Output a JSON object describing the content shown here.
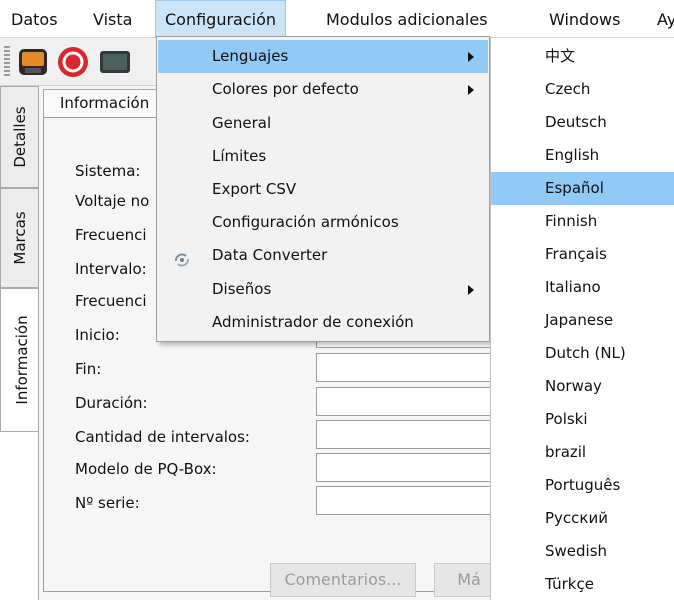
{
  "menubar": {
    "items": [
      "Datos",
      "Vista",
      "Configuración",
      "Modulos adicionales",
      "Windows",
      "Ay"
    ],
    "active_index": 2
  },
  "toolbar": {
    "buttons": [
      "disk-save-icon",
      "refresh-icon",
      "monitor-icon"
    ]
  },
  "side_tabs": [
    "Detalles",
    "Marcas",
    "Información"
  ],
  "panel": {
    "tab_label": "Información",
    "fields": [
      {
        "label": "Sistema:",
        "value": ""
      },
      {
        "label": "Voltaje no",
        "value": ""
      },
      {
        "label": "Frecuenci",
        "value": ""
      },
      {
        "label": "Intervalo:",
        "value": ""
      },
      {
        "label": "Frecuenci",
        "value": ""
      },
      {
        "label": "Inicio:",
        "value": ""
      },
      {
        "label": "Fin:",
        "value": ""
      },
      {
        "label": "Duración:",
        "value": ""
      },
      {
        "label": "Cantidad de intervalos:",
        "value": ""
      },
      {
        "label": "Modelo de PQ-Box:",
        "value": ""
      },
      {
        "label": "Nº serie:",
        "value": ""
      }
    ],
    "buttons": {
      "comments": "Comentarios...",
      "more": "Má"
    }
  },
  "config_menu": {
    "items": [
      {
        "label": "Lenguajes",
        "submenu": true,
        "highlighted": true,
        "icon": ""
      },
      {
        "label": "Colores por defecto",
        "submenu": true,
        "highlighted": false,
        "icon": ""
      },
      {
        "label": "General",
        "submenu": false,
        "highlighted": false,
        "icon": ""
      },
      {
        "label": "Límites",
        "submenu": false,
        "highlighted": false,
        "icon": ""
      },
      {
        "label": "Export CSV",
        "submenu": false,
        "highlighted": false,
        "icon": ""
      },
      {
        "label": "Configuración armónicos",
        "submenu": false,
        "highlighted": false,
        "icon": ""
      },
      {
        "label": "Data Converter",
        "submenu": false,
        "highlighted": false,
        "icon": "converter-icon"
      },
      {
        "label": "Diseños",
        "submenu": true,
        "highlighted": false,
        "icon": ""
      },
      {
        "label": "Administrador de conexión",
        "submenu": false,
        "highlighted": false,
        "icon": ""
      }
    ]
  },
  "languages": {
    "items": [
      "中文",
      "Czech",
      "Deutsch",
      "English",
      "Español",
      "Finnish",
      "Français",
      "Italiano",
      "Japanese",
      "Dutch (NL)",
      "Norway",
      "Polski",
      "brazil",
      "Português",
      "Русский",
      "Swedish",
      "Türkçe"
    ],
    "highlighted": "Español"
  },
  "colors": {
    "highlight": "#91c9f7",
    "menubar_active": "#cce4f7"
  }
}
